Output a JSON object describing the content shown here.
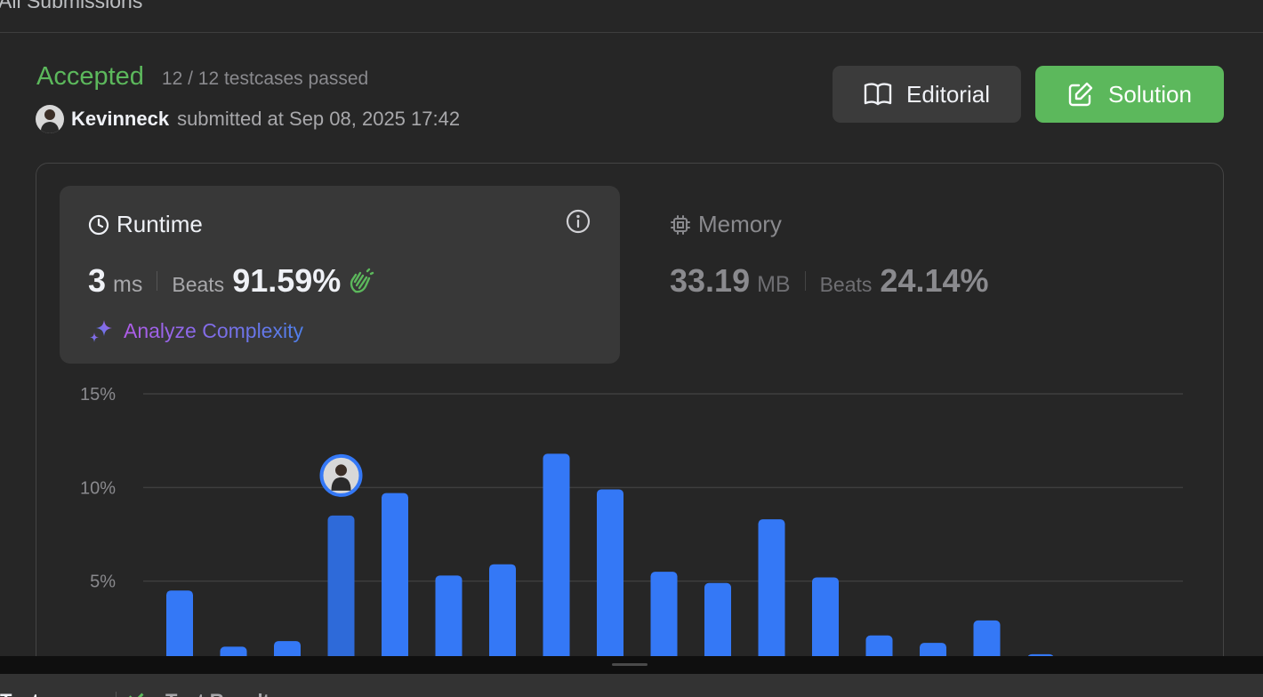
{
  "header": {
    "title": "All Submissions"
  },
  "submission": {
    "status": "Accepted",
    "testcases": "12 / 12 testcases passed",
    "username": "Kevinneck",
    "submitted_text": "submitted at Sep 08, 2025 17:42"
  },
  "actions": {
    "editorial_label": "Editorial",
    "solution_label": "Solution"
  },
  "runtime": {
    "title": "Runtime",
    "value": "3",
    "unit": "ms",
    "beats_label": "Beats",
    "beats_value": "91.59%",
    "analyze_label": "Analyze Complexity"
  },
  "memory": {
    "title": "Memory",
    "value": "33.19",
    "unit": "MB",
    "beats_label": "Beats",
    "beats_value": "24.14%"
  },
  "bottom_tabs": [
    "Testcase",
    "Test Result"
  ],
  "colors": {
    "accepted": "#5cb85c",
    "bar": "#3478f6",
    "bar_selected": "#2e6ad9",
    "background": "#262626"
  },
  "chart_data": {
    "type": "bar",
    "yticks": [
      "15%",
      "10%",
      "5%"
    ],
    "ylim": [
      0,
      15
    ],
    "values": [
      4.5,
      1.5,
      1.8,
      8.5,
      9.7,
      5.3,
      5.9,
      11.8,
      9.9,
      5.5,
      4.9,
      8.3,
      5.2,
      2.1,
      1.7,
      2.9,
      1.1
    ],
    "selected_index": 3,
    "marker": "user-avatar"
  }
}
